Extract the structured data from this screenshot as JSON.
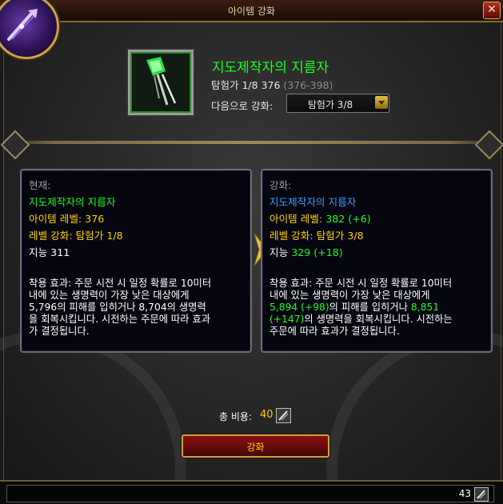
{
  "window": {
    "title": "아이템 강화",
    "close_label": "✕"
  },
  "item": {
    "name": "지도제작자의 지름자",
    "track_line": "탐험가 1/8 376",
    "track_range": "(376-398)",
    "upgrade_to_label": "다음으로 강화:",
    "upgrade_to_value": "탐험가 3/8"
  },
  "current": {
    "heading": "현재:",
    "name": "지도제작자의 지름자",
    "item_level": "아이템 레벨: 376",
    "upgrade_level": "레벨 강화: 탐험가 1/8",
    "stat": "지능 311",
    "effect_lines": [
      "착용 효과: 주문 시전 시 일정 확률로 10미터",
      "내에 있는 생명력이 가장 낮은 대상에게",
      "5,796의 피해를 입히거나 8,704의 생명력",
      "을 회복시킵니다. 시전하는 주문에 따라 효과",
      "가 결정됩니다."
    ]
  },
  "upgraded": {
    "heading": "강화:",
    "name": "지도제작자의 지름자",
    "item_level_label": "아이템 레벨: ",
    "item_level_value": "382 (+6)",
    "upgrade_level": "레벨 강화: 탐험가 3/8",
    "stat_label": "지능 ",
    "stat_value": "329 (+18)",
    "effect_line1": "착용 효과: 주문 시전 시 일정 확률로 10미터",
    "effect_line2": "내에 있는 생명력이 가장 낮은 대상에게",
    "effect_dmg": "5,894 (+98)",
    "effect_mid": "의 피해를 입히거나 ",
    "effect_heal_a": "8,851",
    "effect_heal_b": "(+147)",
    "effect_tail": "의 생명력을 회복시킵니다. 시전하는",
    "effect_line5": "주문에 따라 효과가 결정됩니다."
  },
  "cost": {
    "label": "총 비용:",
    "value": "40"
  },
  "upgrade_button": {
    "label": "강화"
  },
  "currency": {
    "amount": "43"
  },
  "colors": {
    "uncommon_green": "#1eff1e",
    "upgrade_blue": "#3aa0ff",
    "gold_text": "#ffd200",
    "button_red": "#8a1010"
  }
}
